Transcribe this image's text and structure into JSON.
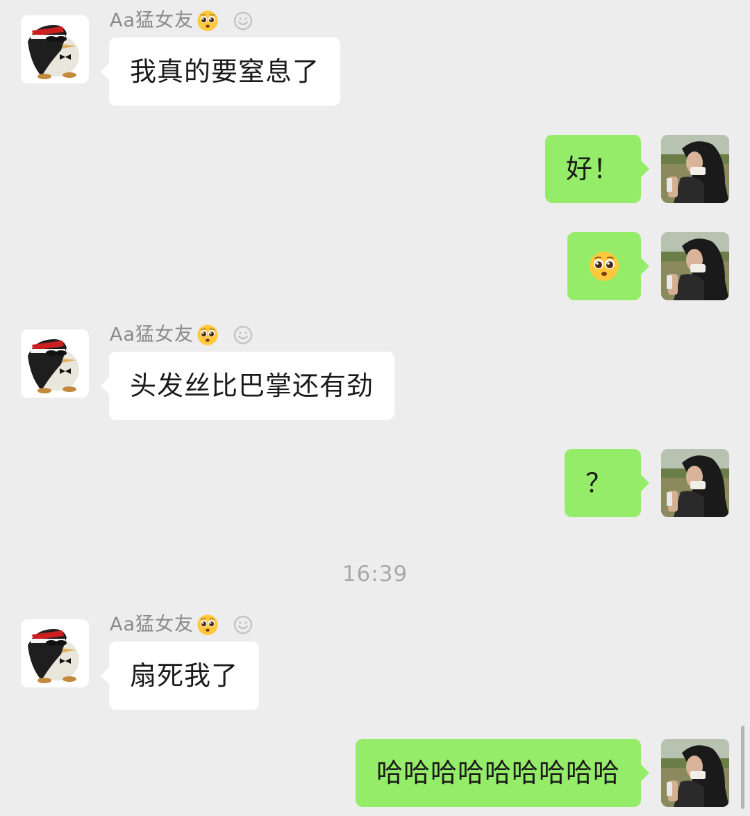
{
  "contact": {
    "nickname": "Aa猛女友"
  },
  "messages": [
    {
      "side": "in",
      "text": "我真的要窒息了"
    },
    {
      "side": "out",
      "text": "好！"
    },
    {
      "side": "out",
      "emoji": "pleading-face-emoji"
    },
    {
      "side": "in",
      "text": "头发丝比巴掌还有劲"
    },
    {
      "side": "out",
      "text": "？"
    },
    {
      "side": "in",
      "text": "扇死我了"
    },
    {
      "side": "out",
      "text": "哈哈哈哈哈哈哈哈哈"
    }
  ],
  "timestamp": "16:39",
  "colors": {
    "background": "#ededed",
    "incoming_bubble": "#ffffff",
    "outgoing_bubble": "#95ec69",
    "nickname": "#8a8a8a",
    "timestamp": "#a8a8a8"
  },
  "icons": {
    "nickname_emoji": "pleading-face-emoji",
    "sticker": "smiley-sticker-icon"
  }
}
